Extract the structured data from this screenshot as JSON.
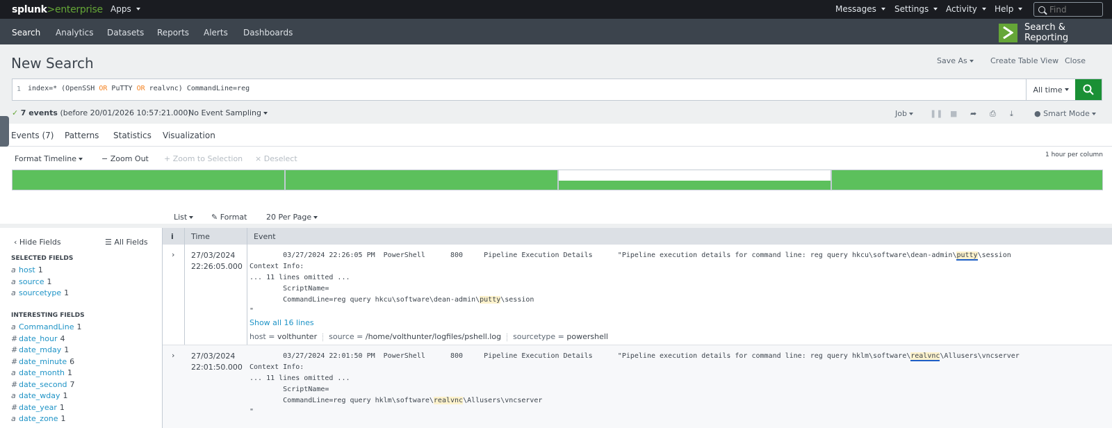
{
  "topbar": {
    "logo_main": "splunk",
    "logo_gt": ">",
    "logo_product": "enterprise",
    "apps_label": "Apps",
    "messages_label": "Messages",
    "settings_label": "Settings",
    "activity_label": "Activity",
    "help_label": "Help",
    "find_placeholder": "Find"
  },
  "appbar": {
    "items": [
      "Search",
      "Analytics",
      "Datasets",
      "Reports",
      "Alerts",
      "Dashboards"
    ],
    "app_title": "Search & Reporting"
  },
  "header": {
    "title": "New Search",
    "save_as": "Save As",
    "create_table_view": "Create Table View",
    "close": "Close"
  },
  "search": {
    "line_number": "1",
    "query_parts": [
      "index=* (OpenSSH ",
      "OR",
      " PuTTY ",
      "OR",
      " realvnc) CommandLine=reg"
    ],
    "time_range": "All time"
  },
  "status": {
    "check": "✓",
    "events_count": "7 events",
    "events_detail": "(before 20/01/2026 10:57:21.000)",
    "sampling": "No Event Sampling",
    "job": "Job",
    "mode": "Smart Mode"
  },
  "tabs": [
    "Events (7)",
    "Patterns",
    "Statistics",
    "Visualization"
  ],
  "timeline": {
    "format": "Format Timeline",
    "zoom_out": "Zoom Out",
    "zoom_selection": "Zoom to Selection",
    "deselect": "Deselect",
    "per_column": "1 hour per column",
    "bar_levels": [
      1.0,
      1.0,
      0.45,
      1.0
    ]
  },
  "list_controls": {
    "list": "List",
    "format": "Format",
    "per_page": "20 Per Page"
  },
  "sidebar": {
    "hide_fields": "Hide Fields",
    "all_fields": "All Fields",
    "selected_heading": "SELECTED FIELDS",
    "interesting_heading": "INTERESTING FIELDS",
    "selected": [
      {
        "type": "a",
        "name": "host",
        "count": "1"
      },
      {
        "type": "a",
        "name": "source",
        "count": "1"
      },
      {
        "type": "a",
        "name": "sourcetype",
        "count": "1"
      }
    ],
    "interesting": [
      {
        "type": "a",
        "name": "CommandLine",
        "count": "1"
      },
      {
        "type": "#",
        "name": "date_hour",
        "count": "4"
      },
      {
        "type": "#",
        "name": "date_mday",
        "count": "1"
      },
      {
        "type": "#",
        "name": "date_minute",
        "count": "6"
      },
      {
        "type": "a",
        "name": "date_month",
        "count": "1"
      },
      {
        "type": "#",
        "name": "date_second",
        "count": "7"
      },
      {
        "type": "a",
        "name": "date_wday",
        "count": "1"
      },
      {
        "type": "#",
        "name": "date_year",
        "count": "1"
      },
      {
        "type": "a",
        "name": "date_zone",
        "count": "1"
      }
    ]
  },
  "results": {
    "col_info": "i",
    "col_time": "Time",
    "col_event": "Event",
    "events": [
      {
        "date": "27/03/2024",
        "time": "22:26:05.000",
        "line1_pre": "        03/27/2024 22:26:05 PM  PowerShell      800     Pipeline Execution Details      \"Pipeline execution details for command line: reg query hkcu\\software\\dean-admin\\",
        "line1_hl": "putty",
        "line1_post": "\\session",
        "context": "Context Info:",
        "omitted": "... 11 lines omitted ...",
        "script": "        ScriptName=",
        "cmd_pre": "        CommandLine=reg query hkcu\\software\\dean-admin\\",
        "cmd_hl": "putty",
        "cmd_post": "\\session",
        "quote": "\"",
        "show_all": "Show all 16 lines",
        "host_label": "host = ",
        "host": "volthunter",
        "source_label": "source = ",
        "source": "/home/volthunter/logfiles/pshell.log",
        "sourcetype_label": "sourcetype = ",
        "sourcetype": "powershell"
      },
      {
        "date": "27/03/2024",
        "time": "22:01:50.000",
        "line1_pre": "        03/27/2024 22:01:50 PM  PowerShell      800     Pipeline Execution Details      \"Pipeline execution details for command line: reg query hklm\\software\\",
        "line1_hl": "realvnc",
        "line1_post": "\\Allusers\\vncserver",
        "context": "Context Info:",
        "omitted": "... 11 lines omitted ...",
        "script": "        ScriptName=",
        "cmd_pre": "        CommandLine=reg query hklm\\software\\",
        "cmd_hl": "realvnc",
        "cmd_post": "\\Allusers\\vncserver",
        "quote": "\""
      }
    ]
  },
  "colors": {
    "accent": "#1e93c6",
    "brand_green": "#65a637",
    "go_button": "#1a9035",
    "timeline_fill": "#5cc05c"
  }
}
